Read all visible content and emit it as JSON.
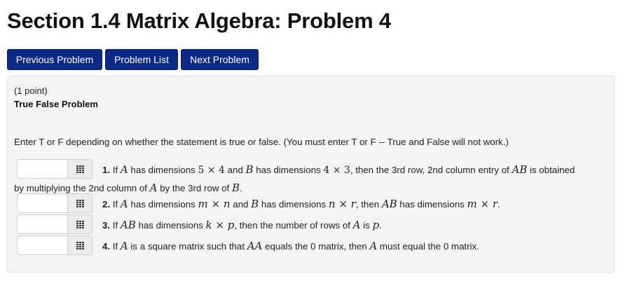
{
  "page": {
    "title": "Section 1.4 Matrix Algebra: Problem 4"
  },
  "nav": {
    "previous": "Previous Problem",
    "list": "Problem List",
    "next": "Next Problem"
  },
  "problem": {
    "points": "(1 point)",
    "subtitle": "True False Problem",
    "instructions": "Enter T or F depending on whether the statement is true or false. (You must enter T or F -- True and False will not work.)",
    "questions": [
      {
        "number": "1.",
        "answer": "",
        "t1": "If ",
        "m1": "A",
        "t2": " has dimensions ",
        "m2": "5 × 4",
        "t3": " and ",
        "m3": "B",
        "t4": " has dimensions ",
        "m4": "4 × 3",
        "t5": ", then the 3rd row, 2nd column entry of ",
        "m5": "AB",
        "t6": " is obtained",
        "w1": "by multiplying the 2nd column of ",
        "wm1": "A",
        "w2": " by the 3rd row of ",
        "wm2": "B",
        "w3": "."
      },
      {
        "number": "2.",
        "answer": "",
        "t1": "If ",
        "m1": "A",
        "t2": " has dimensions ",
        "m2": "m × n",
        "t3": " and ",
        "m3": "B",
        "t4": " has dimensions ",
        "m4": "n × r",
        "t5": ", then ",
        "m5": "AB",
        "t6": " has dimensions ",
        "m6": "m × r",
        "t7": "."
      },
      {
        "number": "3.",
        "answer": "",
        "t1": "If ",
        "m1": "AB",
        "t2": " has dimensions ",
        "m2": "k × p",
        "t3": ", then the number of rows of ",
        "m3": "A",
        "t4": " is ",
        "m4": "p",
        "t5": "."
      },
      {
        "number": "4.",
        "answer": "",
        "t1": "If ",
        "m1": "A",
        "t2": " is a square matrix such that ",
        "m2": "AA",
        "t3": " equals the 0 matrix, then ",
        "m3": "A",
        "t4": " must equal the 0 matrix."
      }
    ]
  },
  "icons": {
    "answer_helper": "grid-icon"
  }
}
